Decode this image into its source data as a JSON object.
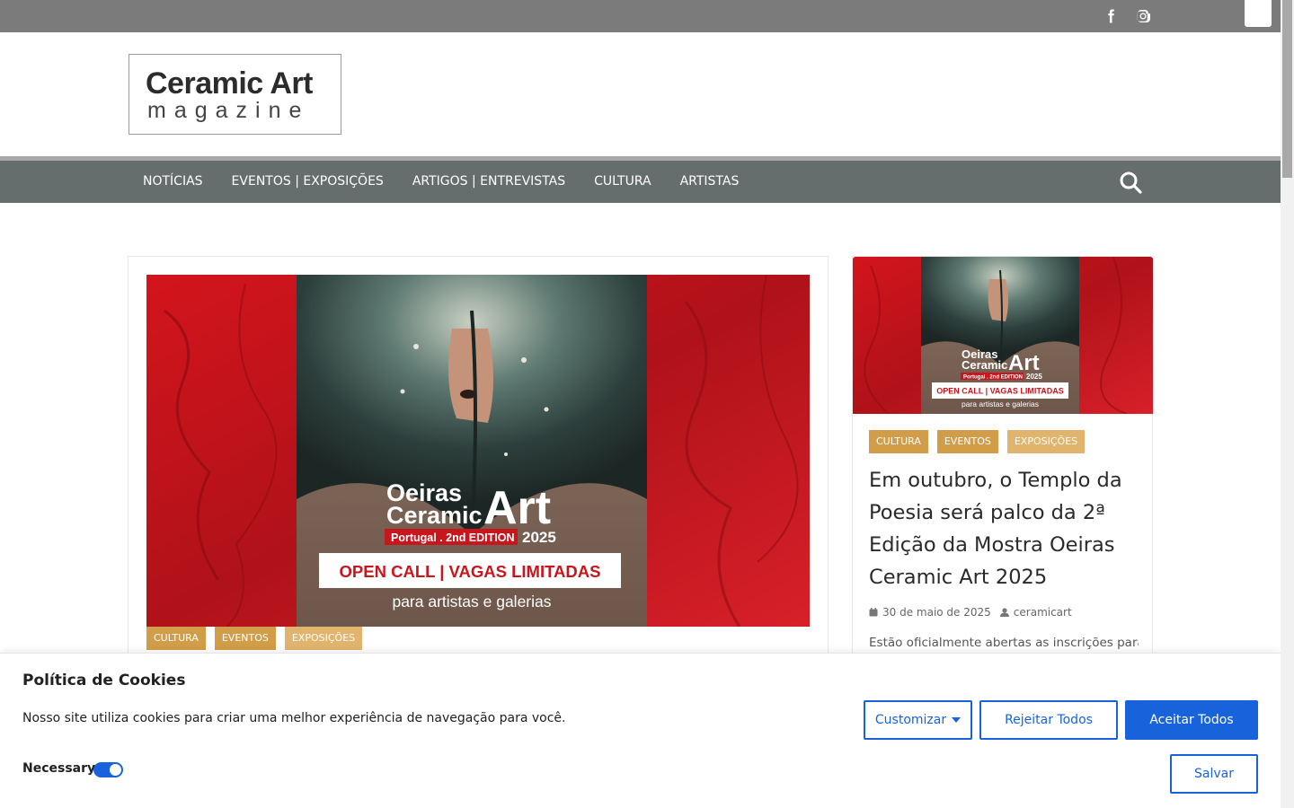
{
  "topbar": {
    "social": [
      {
        "name": "facebook-icon"
      },
      {
        "name": "instagram-icon"
      }
    ]
  },
  "header": {
    "logo_line1": "Ceramic Art",
    "logo_line2": "magazine"
  },
  "nav": {
    "items": [
      {
        "label": "NOTÍCIAS"
      },
      {
        "label": "EVENTOS | EXPOSIÇÕES"
      },
      {
        "label": "ARTIGOS | ENTREVISTAS"
      },
      {
        "label": "CULTURA"
      },
      {
        "label": "ARTISTAS"
      }
    ],
    "search_icon": "search-icon"
  },
  "poster": {
    "line1": "Oeiras",
    "line2": "Ceramic",
    "art": "Art",
    "edition": "Portugal . 2nd EDITION",
    "year": "2025",
    "open_call": "OPEN CALL  |  VAGAS LIMITADAS",
    "tagline": "para artistas e galerias"
  },
  "main_post": {
    "categories": [
      "CULTURA",
      "EVENTOS",
      "EXPOSIÇÕES"
    ]
  },
  "side_post": {
    "categories": [
      "CULTURA",
      "EVENTOS",
      "EXPOSIÇÕES"
    ],
    "title": "Em outubro, o Templo da Poesia será palco da 2ª Edição da Mostra Oeiras Ceramic Art 2025",
    "date": "30 de maio de 2025",
    "author": "ceramicart",
    "excerpt": "Estão oficialmente abertas as inscrições para"
  },
  "cookie": {
    "title": "Política de Cookies",
    "text": "Nosso site utiliza cookies para criar uma melhor experiência de navegação para você.",
    "necessary_label": "Necessary",
    "customize_label": "Customizar",
    "reject_label": "Rejeitar Todos",
    "accept_label": "Aceitar Todos",
    "save_label": "Salvar"
  },
  "colors": {
    "topbar": "#7b7b7b",
    "nav": "#666e6d",
    "category": "#d29d48",
    "category_light": "#e0b46d",
    "button_blue": "#1863dc",
    "poster_red": "#c8161d"
  }
}
